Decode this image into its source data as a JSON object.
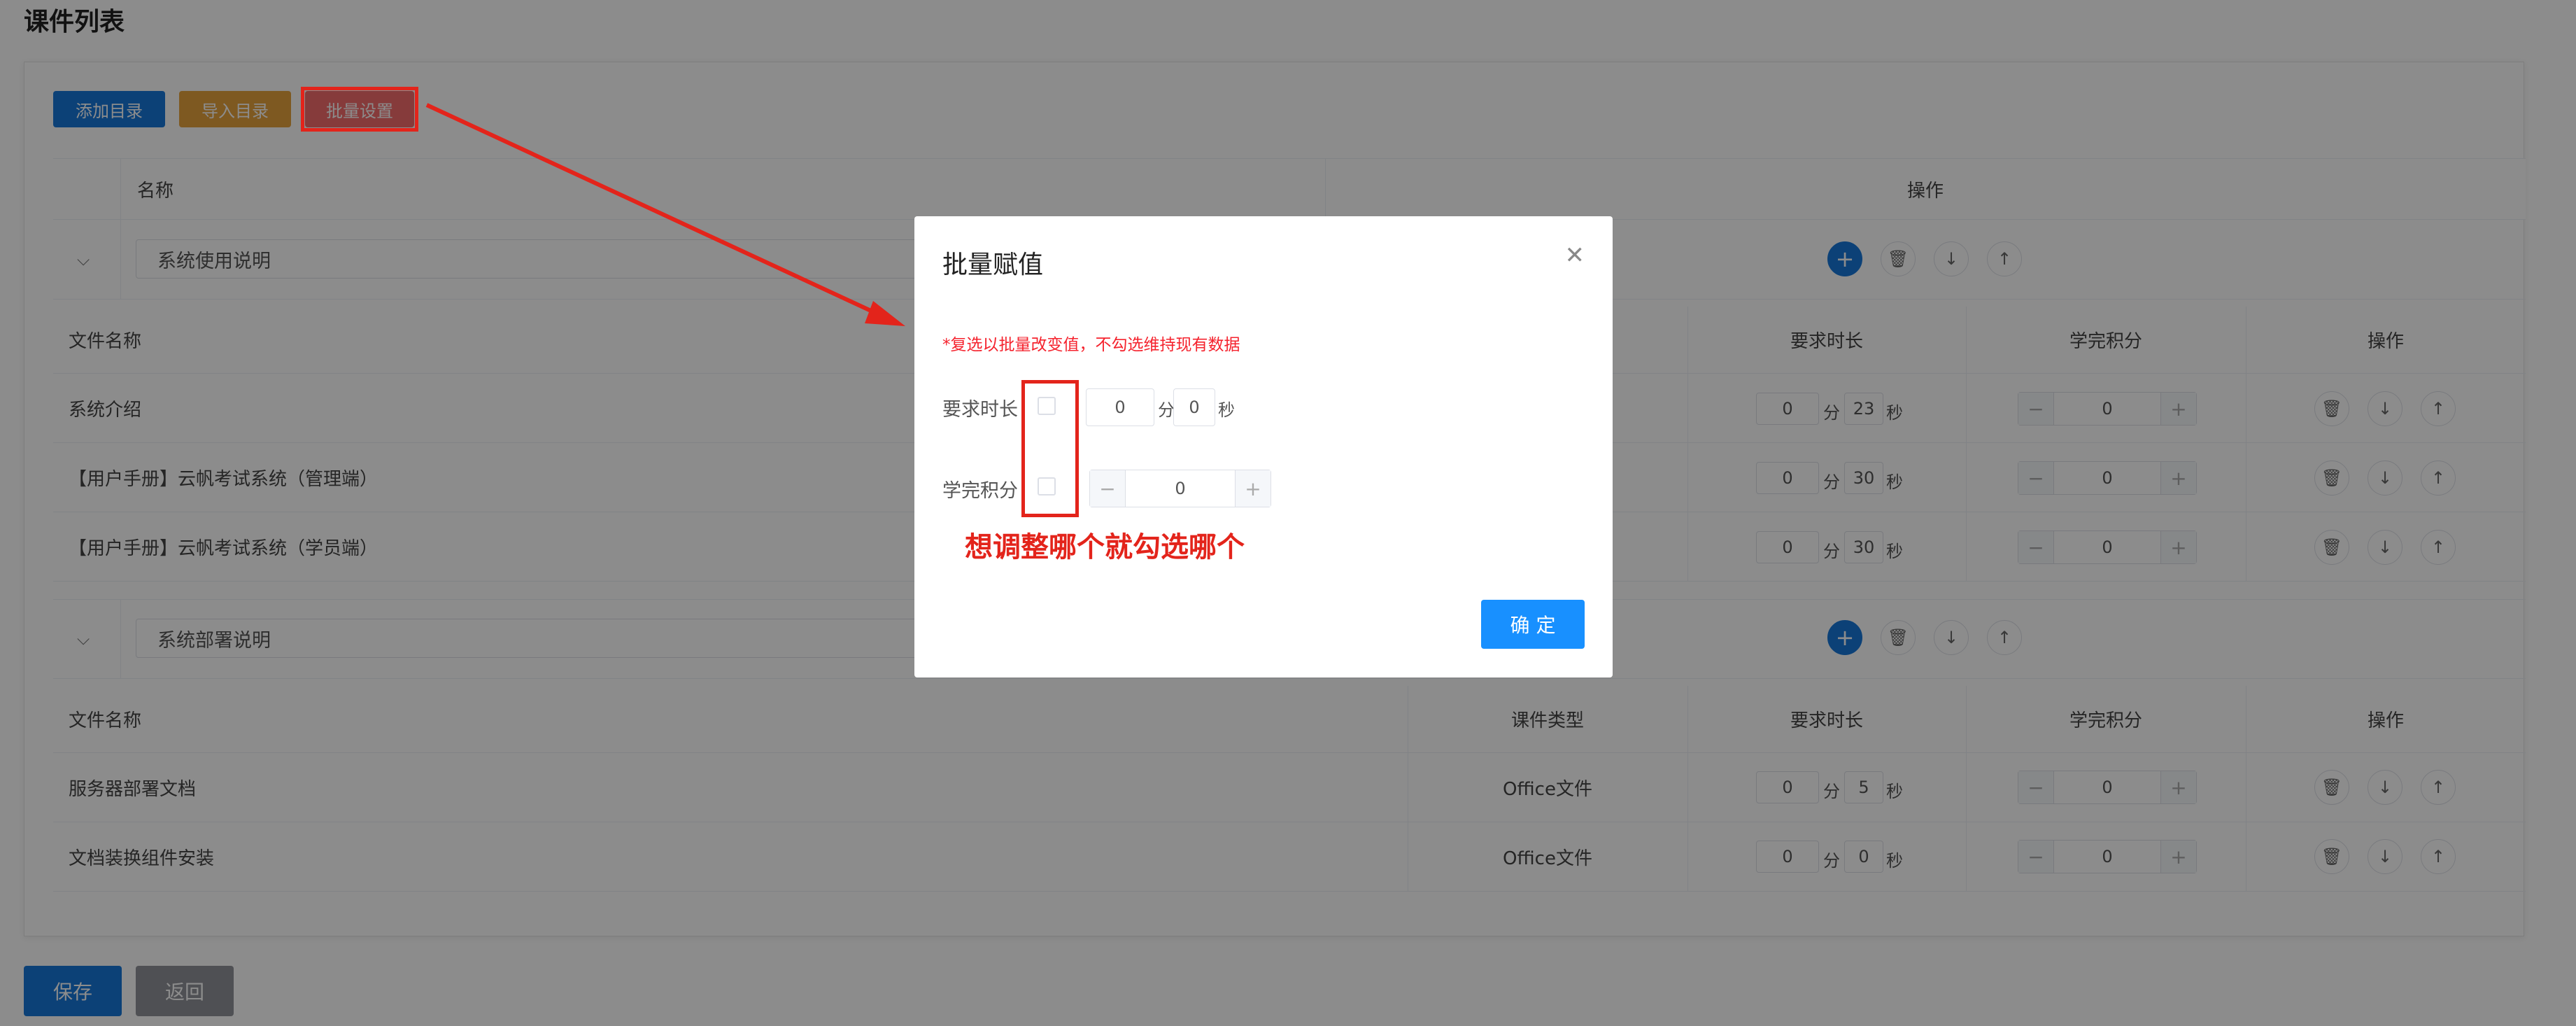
{
  "page_title": "课件列表",
  "toolbar": {
    "add_dir": "添加目录",
    "import_dir": "导入目录",
    "batch": "批量设置"
  },
  "table": {
    "col_name": "名称",
    "col_ops": "操作"
  },
  "file_headers": {
    "file_name": "文件名称",
    "type": "课件类型",
    "duration": "要求时长",
    "points": "学完积分",
    "ops": "操作"
  },
  "units": {
    "min": "分",
    "sec": "秒"
  },
  "dirs": [
    {
      "name": "系统使用说明",
      "files": [
        {
          "name": "系统介绍",
          "type": "",
          "min": "0",
          "sec": "23",
          "points": "0"
        },
        {
          "name": "【用户手册】云帆考试系统（管理端）",
          "type": "",
          "min": "0",
          "sec": "30",
          "points": "0"
        },
        {
          "name": "【用户手册】云帆考试系统（学员端）",
          "type": "",
          "min": "0",
          "sec": "30",
          "points": "0"
        }
      ]
    },
    {
      "name": "系统部署说明",
      "files": [
        {
          "name": "服务器部署文档",
          "type": "Office文件",
          "min": "0",
          "sec": "5",
          "points": "0"
        },
        {
          "name": "文档装换组件安装",
          "type": "Office文件",
          "min": "0",
          "sec": "0",
          "points": "0"
        }
      ]
    }
  ],
  "footer": {
    "save": "保存",
    "back": "返回"
  },
  "dialog": {
    "title": "批量赋值",
    "hint": "*复选以批量改变值，不勾选维持现有数据",
    "duration_label": "要求时长",
    "duration_min": "0",
    "duration_sec": "0",
    "points_label": "学完积分",
    "points_value": "0",
    "confirm": "确 定"
  },
  "annotation": "想调整哪个就勾选哪个",
  "icons": {
    "add": "plus-icon",
    "delete": "trash-icon",
    "down": "arrow-down-icon",
    "up": "arrow-up-icon",
    "close": "close-icon",
    "expand": "chevron-down-icon"
  },
  "colors": {
    "primary": "#1677d9",
    "warning": "#e6a23c",
    "danger": "#f56c6c",
    "annotation_red": "#e3241b"
  }
}
